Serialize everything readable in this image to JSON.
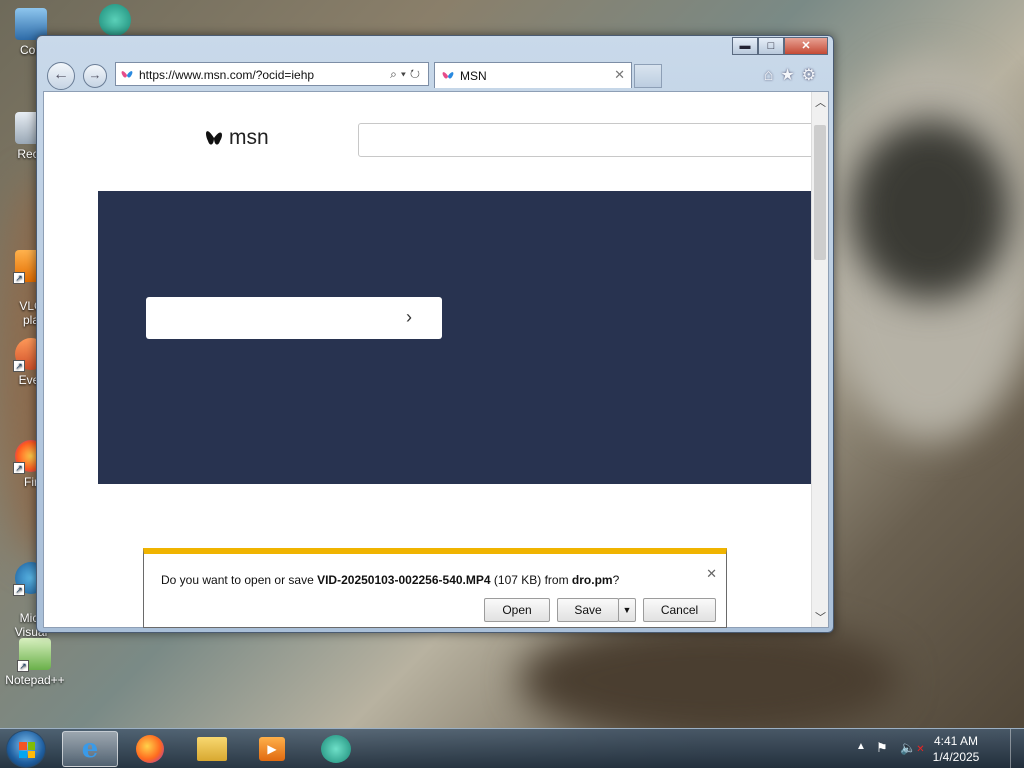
{
  "desktop": {
    "icons": [
      {
        "label": "Con"
      },
      {
        "label": "Recy"
      },
      {
        "label": "VLC\npla"
      },
      {
        "label": "Ever"
      },
      {
        "label": "Fir"
      },
      {
        "label": "Micr\nVisual"
      },
      {
        "label": "Notepad++"
      }
    ]
  },
  "browser": {
    "address_url": "https://www.msn.com/?ocid=iehp",
    "tab_title": "MSN",
    "page": {
      "logo_text": "msn",
      "search_value": ""
    },
    "download_bar": {
      "prefix": "Do you want to open or save ",
      "filename": "VID-20250103-002256-540.MP4",
      "size": " (107 KB) from ",
      "source": "dro.pm",
      "suffix": "?",
      "open_label": "Open",
      "save_label": "Save",
      "cancel_label": "Cancel"
    }
  },
  "taskbar": {
    "clock_time": "4:41 AM",
    "clock_date": "1/4/2025"
  },
  "colors": {
    "hero_bg": "#283350",
    "notif_accent": "#f0b400"
  }
}
